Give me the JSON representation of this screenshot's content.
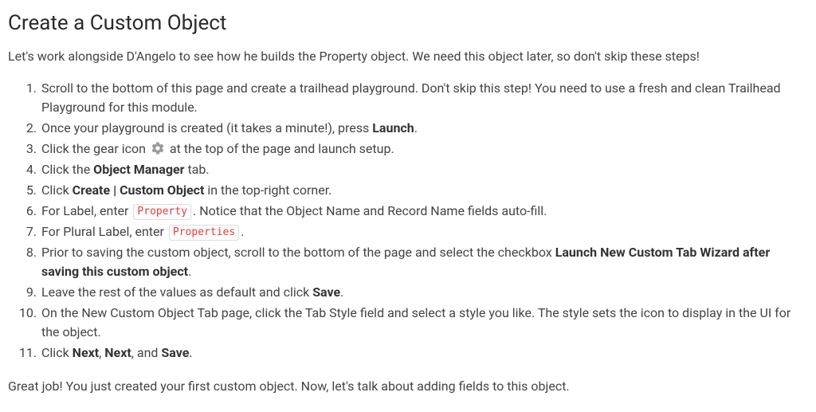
{
  "title": "Create a Custom Object",
  "intro": "Let's work alongside D'Angelo to see how he builds the Property object. We need this object later, so don't skip these steps!",
  "outro": "Great job! You just created your first custom object. Now, let's talk about adding fields to this object.",
  "codes": {
    "property": "Property",
    "properties": "Properties"
  },
  "bold": {
    "launch": "Launch",
    "object_manager": "Object Manager",
    "create_custom_object": "Create | Custom Object",
    "launch_wizard": "Launch New Custom Tab Wizard after saving this custom object",
    "save": "Save",
    "next": "Next"
  },
  "steps": {
    "s1": "Scroll to the bottom of this page and create a trailhead playground. Don't skip this step! You need to use a fresh and clean Trailhead Playground for this module.",
    "s2_a": "Once your playground is created (it takes a minute!), press ",
    "s2_b": ".",
    "s3_a": "Click the gear icon ",
    "s3_b": " at the top of the page and launch setup.",
    "s4_a": "Click the ",
    "s4_b": " tab.",
    "s5_a": "Click ",
    "s5_b": " in the top-right corner.",
    "s6_a": "For Label, enter ",
    "s6_b": ". Notice that the Object Name and Record Name fields auto-fill.",
    "s7_a": "For Plural Label, enter ",
    "s7_b": ".",
    "s8_a": "Prior to saving the custom object, scroll to the bottom of the page and select the checkbox ",
    "s8_b": ".",
    "s9_a": "Leave the rest of the values as default and click ",
    "s9_b": ".",
    "s10": "On the New Custom Object Tab page, click the Tab Style field and select a style you like. The style sets the icon to display in the UI for the object.",
    "s11_a": "Click ",
    "s11_b": ", ",
    "s11_c": ", and ",
    "s11_d": "."
  }
}
